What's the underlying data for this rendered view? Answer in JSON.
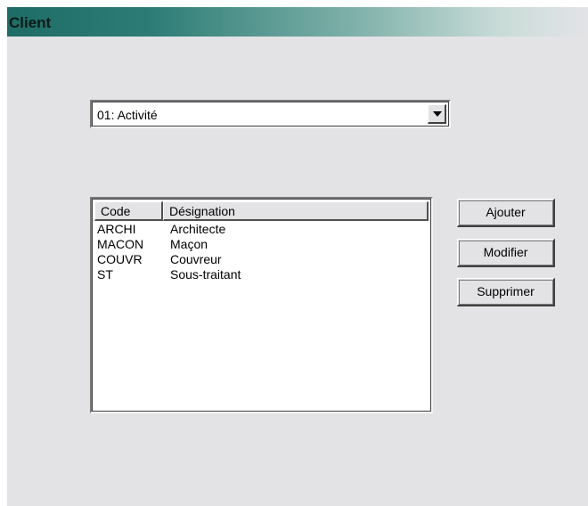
{
  "window": {
    "title": "Client"
  },
  "category_select": {
    "value": "01: Activité"
  },
  "list": {
    "columns": [
      "Code",
      "Désignation"
    ],
    "rows": [
      {
        "code": "ARCHI",
        "designation": "Architecte"
      },
      {
        "code": "MACON",
        "designation": "Maçon"
      },
      {
        "code": "COUVR",
        "designation": "Couvreur"
      },
      {
        "code": "ST",
        "designation": "Sous-traitant"
      }
    ]
  },
  "actions": {
    "add_label": "Ajouter",
    "edit_label": "Modifier",
    "delete_label": "Supprimer"
  },
  "colors": {
    "titlebar_start": "#1e6c66",
    "panel_background": "#e3e3e6"
  },
  "icons": {
    "dropdown": "chevron-down-icon"
  }
}
